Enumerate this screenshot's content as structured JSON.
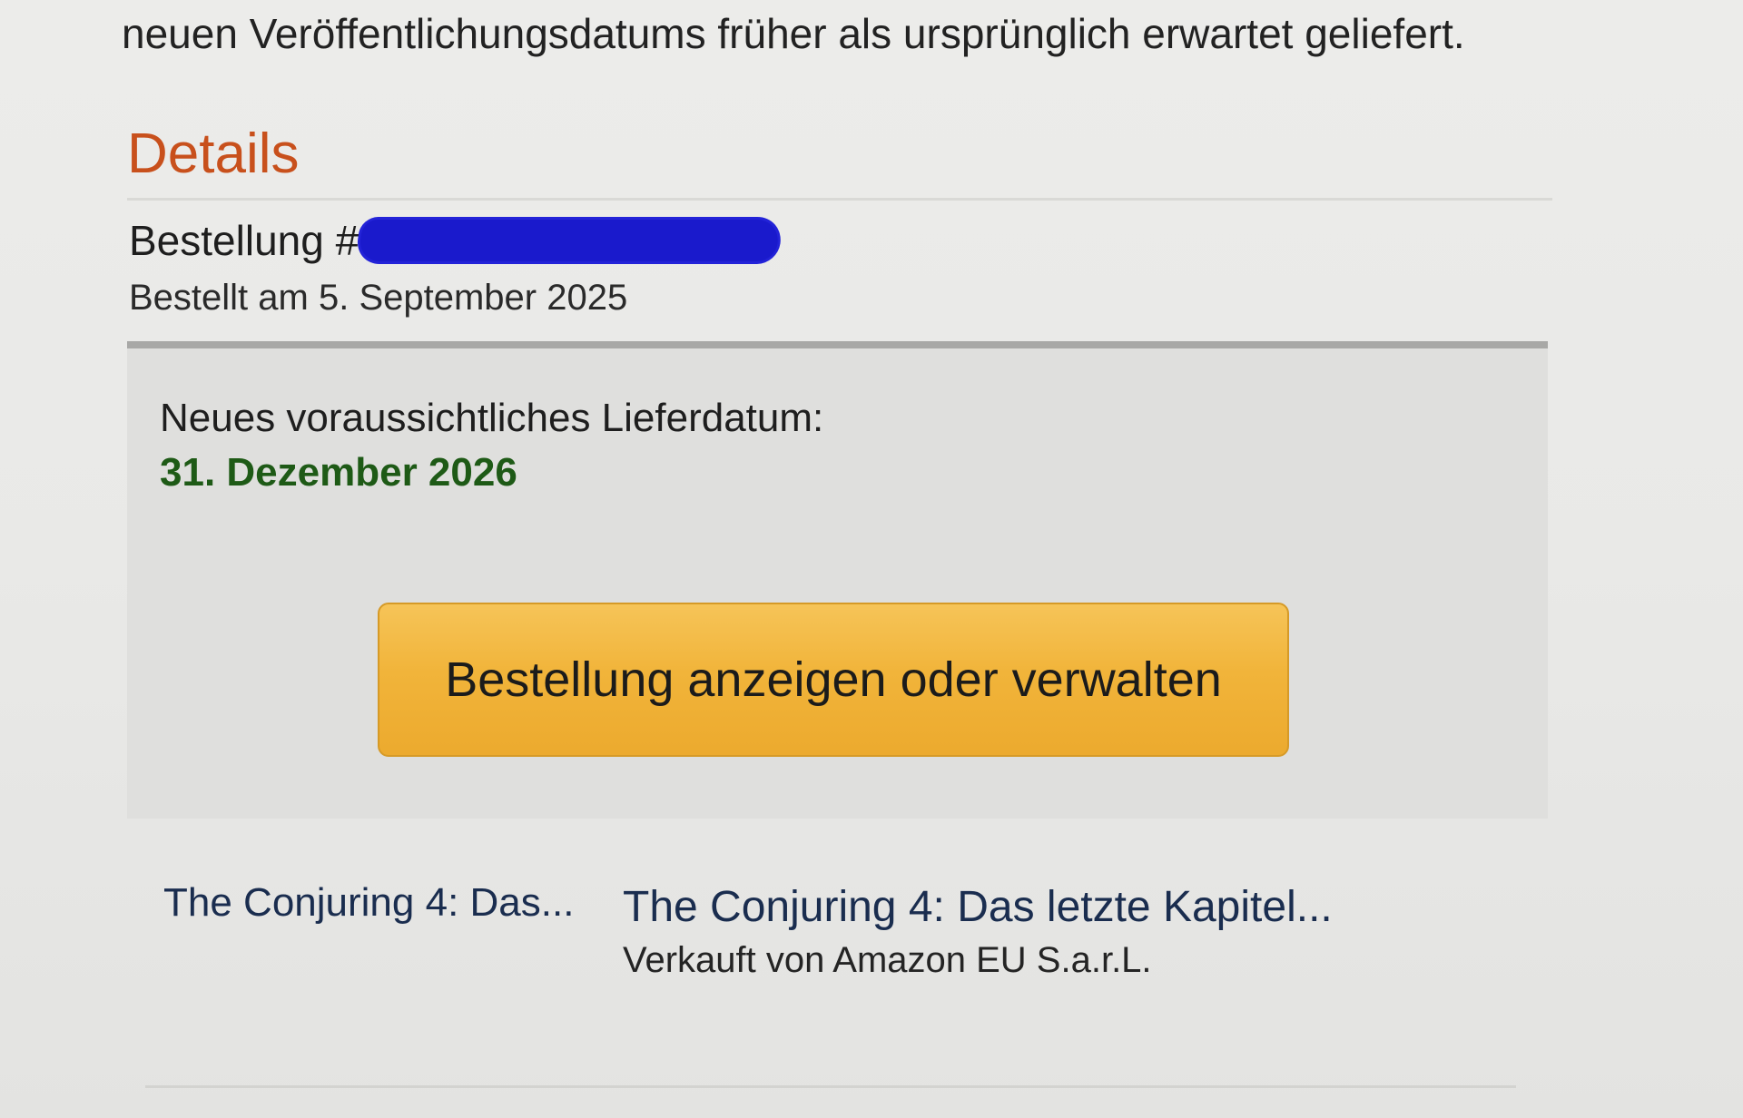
{
  "intro": {
    "text": "neuen Veröffentlichungsdatums früher als ursprünglich erwartet geliefert."
  },
  "details": {
    "title": "Details",
    "order_label": "Bestellung #",
    "order_date": "Bestellt am 5. September 2025"
  },
  "delivery": {
    "label": "Neues voraussichtliches Lieferdatum:",
    "date": "31. Dezember 2026",
    "button_label": "Bestellung anzeigen oder verwalten"
  },
  "item": {
    "short_title": "The Conjuring 4: Das...",
    "title": "The Conjuring 4: Das letzte Kapitel...",
    "seller": "Verkauft von Amazon EU S.a.r.L."
  },
  "colors": {
    "title_accent": "#c8501c",
    "delivery_date": "#1e5a16",
    "button": "#f1b43a",
    "link": "#1a2d4f"
  }
}
